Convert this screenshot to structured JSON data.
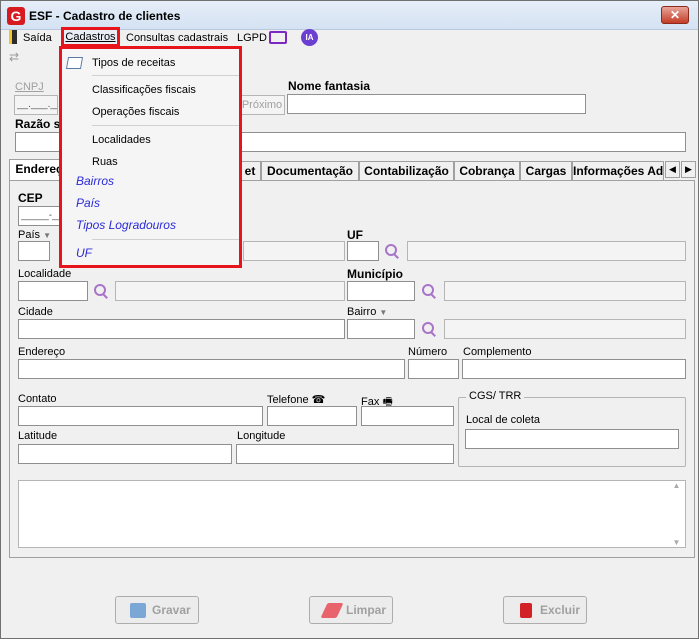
{
  "window": {
    "logo": "G",
    "title": "ESF - Cadastro de clientes",
    "close_label": "✕"
  },
  "menubar": {
    "saida": "Saída",
    "cadastros": "Cadastros",
    "consultas": "Consultas cadastrais",
    "lgpd": "LGPD",
    "ia": "IA"
  },
  "dropdown": {
    "items": [
      {
        "label": "Tipos de receitas",
        "icon": "tag-icon"
      },
      {
        "label": "Classificações fiscais"
      },
      {
        "label": "Operações fiscais"
      },
      {
        "label": "Localidades"
      },
      {
        "label": "Ruas"
      },
      {
        "label": "Bairros"
      },
      {
        "label": "País"
      },
      {
        "label": "Tipos Logradouros"
      },
      {
        "label": "UF"
      }
    ]
  },
  "header": {
    "cnpj_label": "CNPJ",
    "cnpj_value": "__.___.___/____-__",
    "proximo_label": "Próximo",
    "nome_fantasia_label": "Nome fantasia",
    "razao_social_label": "Razão s"
  },
  "tabs": [
    "Endereç",
    "et",
    "Documentação",
    "Contabilização",
    "Cobrança",
    "Cargas",
    "Informações Adi"
  ],
  "form": {
    "cep_label": "CEP",
    "cep_value": "_____-___",
    "pais_label": "País",
    "uf_label": "UF",
    "localidade_label": "Localidade",
    "municipio_label": "Município",
    "cidade_label": "Cidade",
    "bairro_label": "Bairro",
    "endereco_label": "Endereço",
    "numero_label": "Número",
    "complemento_label": "Complemento",
    "contato_label": "Contato",
    "telefone_label": "Telefone",
    "fax_label": "Fax",
    "latitude_label": "Latitude",
    "longitude_label": "Longitude",
    "cgs_group_title": "CGS/ TRR",
    "local_coleta_label": "Local de coleta"
  },
  "buttons": {
    "gravar": "Gravar",
    "limpar": "Limpar",
    "excluir": "Excluir"
  },
  "colors": {
    "highlight": "#e8141b",
    "link_blue": "#2a2ad6",
    "search_icon": "#a874c9"
  }
}
